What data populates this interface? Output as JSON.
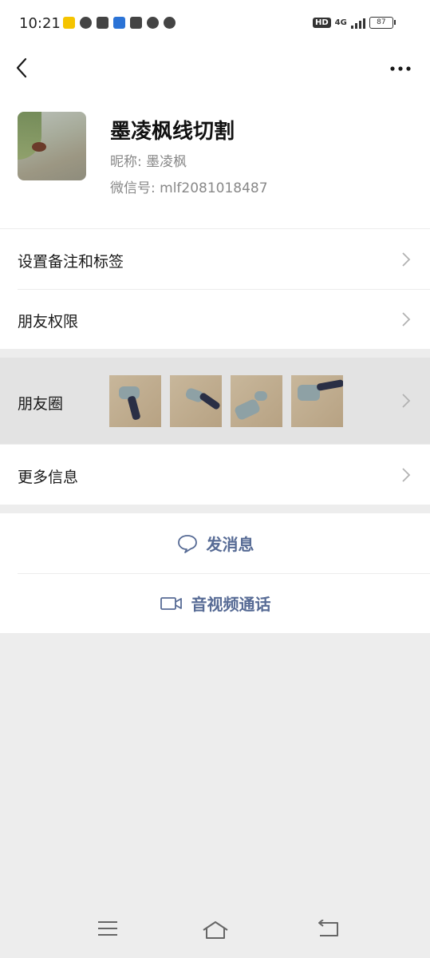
{
  "status": {
    "time": "10:21",
    "network": "4G",
    "battery": "87"
  },
  "profile": {
    "name": "墨凌枫线切割",
    "nickname_label": "昵称:",
    "nickname": "墨凌枫",
    "wechat_id_label": "微信号:",
    "wechat_id": "mlf2081018487"
  },
  "rows": {
    "remark": "设置备注和标签",
    "permissions": "朋友权限",
    "moments": "朋友圈",
    "more_info": "更多信息"
  },
  "actions": {
    "message": "发消息",
    "call": "音视频通话"
  },
  "colors": {
    "accent": "#576b95",
    "background": "#ededed"
  }
}
